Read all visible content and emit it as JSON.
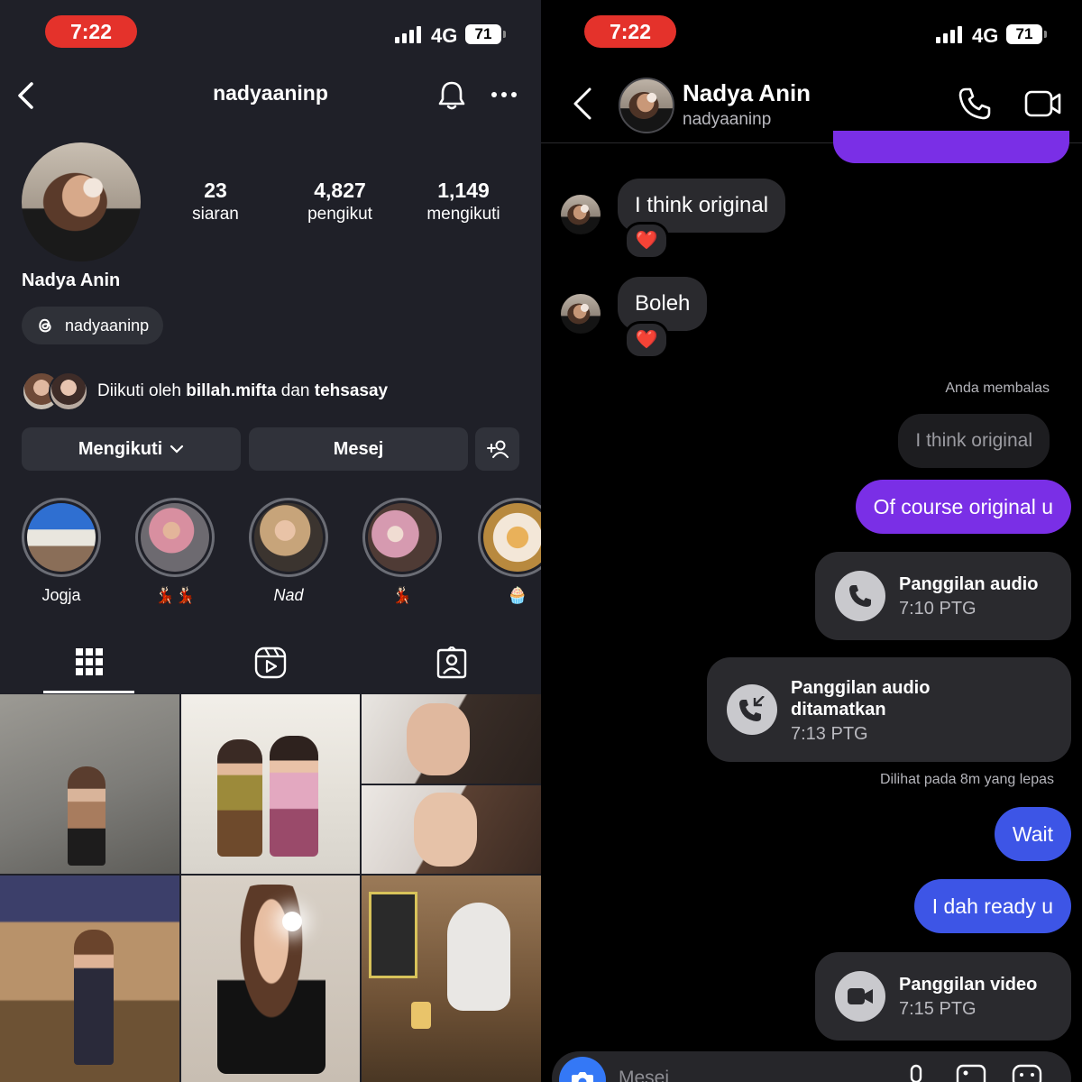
{
  "profile_screen": {
    "status": {
      "time": "7:22",
      "network": "4G",
      "battery": "71"
    },
    "header": {
      "username": "nadyaaninp"
    },
    "stats": [
      {
        "value": "23",
        "label": "siaran"
      },
      {
        "value": "4,827",
        "label": "pengikut"
      },
      {
        "value": "1,149",
        "label": "mengikuti"
      }
    ],
    "display_name": "Nadya Anin",
    "threads_handle": "nadyaaninp",
    "followed_by": {
      "prefix": "Diikuti oleh",
      "user1": "billah.mifta",
      "joiner": "dan",
      "user2": "tehsasay"
    },
    "buttons": {
      "following": "Mengikuti",
      "message": "Mesej"
    },
    "highlights": [
      {
        "caption": "Jogja"
      },
      {
        "caption": "💃🏻💃🏻"
      },
      {
        "caption": "Nad"
      },
      {
        "caption": "💃🏻"
      },
      {
        "caption": "🧁"
      }
    ]
  },
  "chat_screen": {
    "status": {
      "time": "7:22",
      "network": "4G",
      "battery": "71"
    },
    "header": {
      "name": "Nadya Anin",
      "username": "nadyaaninp"
    },
    "messages": {
      "in1": "I think original",
      "in2": "Boleh",
      "reply_label": "Anda membalas",
      "reply_quote": "I think original",
      "out1": "Of course original u",
      "call1": {
        "title": "Panggilan audio",
        "time": "7:10 PTG"
      },
      "call2": {
        "title_line1": "Panggilan audio",
        "title_line2": "ditamatkan",
        "time": "7:13 PTG"
      },
      "seen": "Dilihat pada 8m yang lepas",
      "out2": "Wait",
      "out3": "I dah ready u",
      "call3": {
        "title": "Panggilan video",
        "time": "7:15 PTG"
      }
    },
    "composer": {
      "placeholder": "Mesej"
    },
    "colors": {
      "purple": "#7a2fe6",
      "blue": "#3d55e6",
      "bubble_in": "#2a2a2e"
    }
  }
}
